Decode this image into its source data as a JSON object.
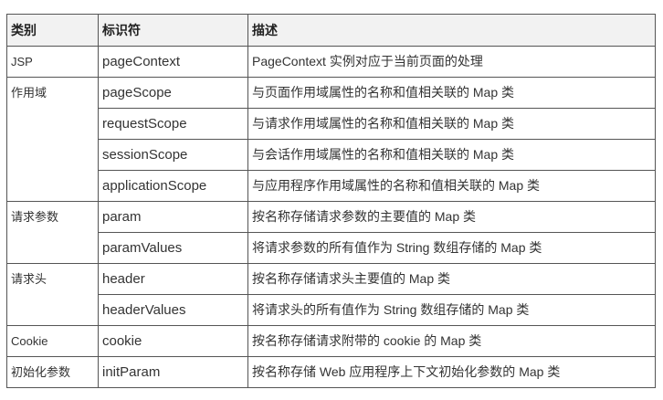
{
  "headers": [
    "类别",
    "标识符",
    "描述"
  ],
  "rows": [
    {
      "category": "JSP",
      "identifier": "pageContext",
      "description": "PageContext 实例对应于当前页面的处理"
    },
    {
      "category": "作用域",
      "identifier": "pageScope",
      "description": "与页面作用域属性的名称和值相关联的 Map 类"
    },
    {
      "category": "",
      "identifier": "requestScope",
      "description": "与请求作用域属性的名称和值相关联的 Map 类"
    },
    {
      "category": "",
      "identifier": "sessionScope",
      "description": "与会话作用域属性的名称和值相关联的 Map 类"
    },
    {
      "category": "",
      "identifier": "applicationScope",
      "description": "与应用程序作用域属性的名称和值相关联的 Map 类"
    },
    {
      "category": "请求参数",
      "identifier": "param",
      "description": "按名称存储请求参数的主要值的 Map 类"
    },
    {
      "category": "",
      "identifier": "paramValues",
      "description": "将请求参数的所有值作为 String 数组存储的 Map 类"
    },
    {
      "category": "请求头",
      "identifier": "header",
      "description": "按名称存储请求头主要值的 Map 类"
    },
    {
      "category": "",
      "identifier": "headerValues",
      "description": "将请求头的所有值作为 String 数组存储的 Map 类"
    },
    {
      "category": "Cookie",
      "identifier": "cookie",
      "description": "按名称存储请求附带的 cookie 的 Map 类"
    },
    {
      "category": "初始化参数",
      "identifier": "initParam",
      "description": "按名称存储 Web 应用程序上下文初始化参数的 Map 类"
    }
  ]
}
